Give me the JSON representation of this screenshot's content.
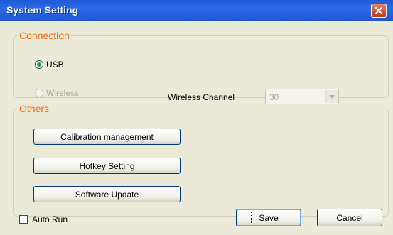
{
  "window": {
    "title": "System Setting"
  },
  "connection": {
    "legend": "Connection",
    "usb_label": "USB",
    "wireless_label": "Wireless",
    "channel_label": "Wireless Channel",
    "channel_value": "30"
  },
  "others": {
    "legend": "Others",
    "calibration_label": "Calibration management",
    "hotkey_label": "Hotkey Setting",
    "update_label": "Software Update"
  },
  "footer": {
    "auto_run_label": "Auto Run",
    "save_label": "Save",
    "cancel_label": "Cancel"
  },
  "colors": {
    "title_bar": "#2c69e9",
    "group_legend": "#f06a10",
    "dialog_background": "#ebe9d8"
  }
}
